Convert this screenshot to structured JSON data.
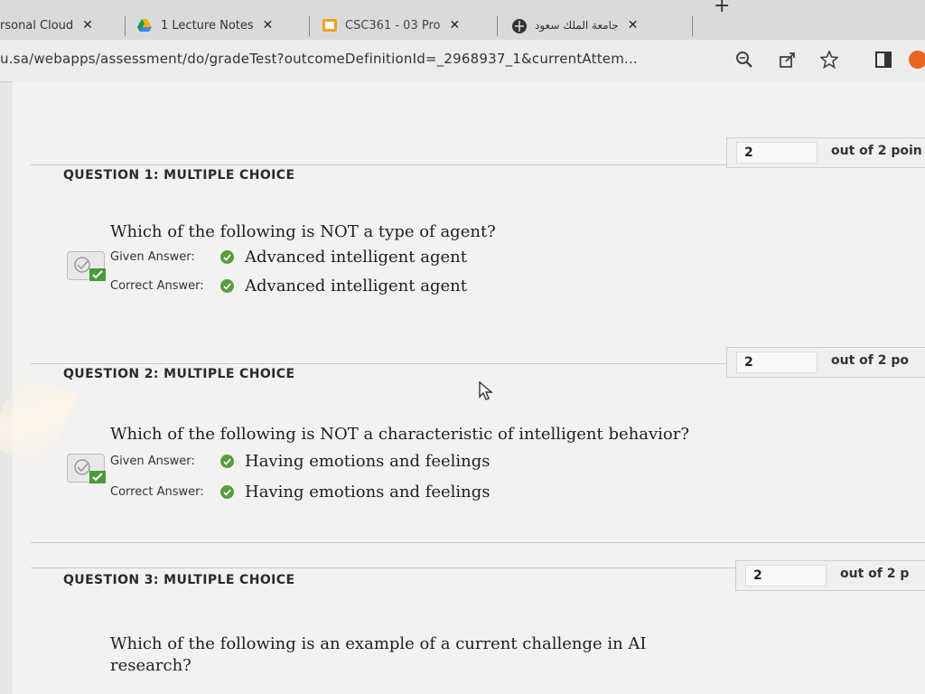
{
  "browser": {
    "tabs": [
      {
        "label": "rsonal Cloud",
        "close": "✕"
      },
      {
        "label": "1 Lecture Notes",
        "close": "✕"
      },
      {
        "label": "CSC361 - 03 Pro",
        "close": "✕"
      },
      {
        "label": "جامعة الملك سعود",
        "close": "✕"
      }
    ],
    "new_tab": "+",
    "url": "u.sa/webapps/assessment/do/gradeTest?outcomeDefinitionId=_2968937_1&currentAttem..."
  },
  "questions": [
    {
      "header": "QUESTION 1:   MULTIPLE CHOICE",
      "points": "2",
      "points_label": "out of 2 poin",
      "text": "Which of the following is NOT a type of agent?",
      "given_label": "Given Answer:",
      "given_value": "Advanced intelligent agent",
      "correct_label": "Correct Answer:",
      "correct_value": "Advanced intelligent agent"
    },
    {
      "header": "QUESTION 2:   MULTIPLE CHOICE",
      "points": "2",
      "points_label": "out of 2 po",
      "text": "Which of the following is NOT a characteristic of intelligent behavior?",
      "given_label": "Given Answer:",
      "given_value": "Having emotions and feelings",
      "correct_label": "Correct Answer:",
      "correct_value": "Having emotions and feelings"
    },
    {
      "header": "QUESTION 3:   MULTIPLE CHOICE",
      "points": "2",
      "points_label": "out of 2 p",
      "text_line1": "Which of the following is an example of a current challenge in AI",
      "text_line2": "research?"
    }
  ],
  "colors": {
    "correct_green": "#5a9c3e",
    "badge_green": "#4b9b3a"
  }
}
